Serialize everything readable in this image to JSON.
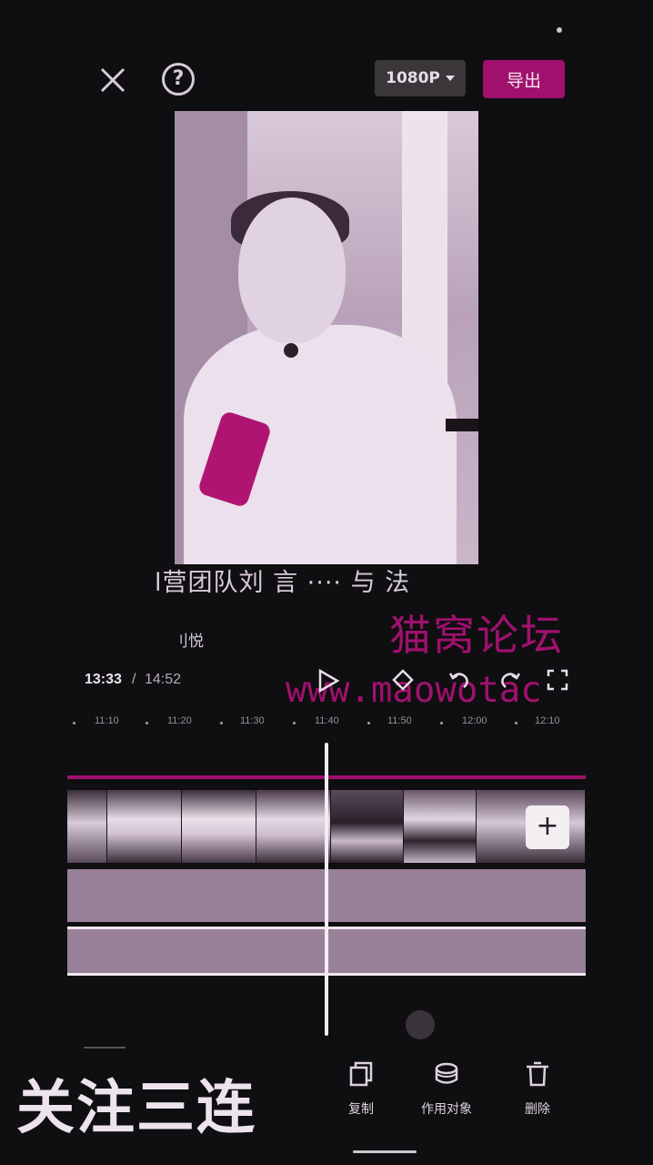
{
  "topbar": {
    "resolution": "1080P",
    "export_label": "导出",
    "help_glyph": "?"
  },
  "preview": {
    "subtitle_line1": "l营团队刘 言 ···· 与 法",
    "subtitle_line2": "刂悦"
  },
  "watermark": {
    "text": "猫窝论坛",
    "url": "www.maowotac"
  },
  "playback": {
    "current_time": "13:33",
    "separator": "/",
    "total_time": "14:52"
  },
  "ruler": {
    "labels": [
      "11:10",
      "11:20",
      "11:30",
      "11:40",
      "11:50",
      "12:00",
      "12:10"
    ]
  },
  "timeline": {
    "add_glyph": "+"
  },
  "bottom": {
    "banner": "关注三连",
    "tools": [
      {
        "label": "复制",
        "icon": "copy-icon"
      },
      {
        "label": "作用对象",
        "icon": "layers-icon"
      },
      {
        "label": "删除",
        "icon": "trash-icon"
      }
    ]
  },
  "colors": {
    "accent": "#a0116e",
    "background": "#0f0e10",
    "track": "#998099"
  }
}
